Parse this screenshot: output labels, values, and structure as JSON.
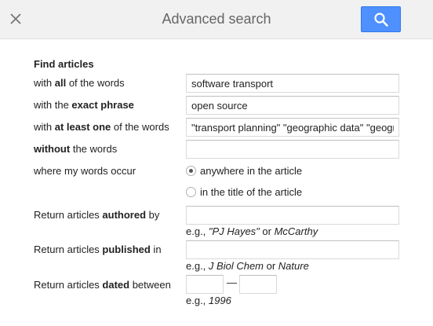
{
  "header": {
    "title": "Advanced search",
    "close_icon": "close-icon",
    "search_icon": "search-icon",
    "accent_color": "#4d90fe"
  },
  "form": {
    "section_title": "Find articles",
    "all_words": {
      "pre": "with ",
      "bold": "all",
      "post": " of the words",
      "value": "software transport"
    },
    "exact_phrase": {
      "pre": "with the ",
      "bold": "exact phrase",
      "post": "",
      "value": "open source"
    },
    "at_least_one": {
      "pre": "with ",
      "bold": "at least one",
      "post": " of the words",
      "value": "\"transport planning\" \"geographic data\" \"geographic information\""
    },
    "without": {
      "pre": "",
      "bold": "without",
      "post": " the words",
      "value": ""
    },
    "occur": {
      "label": "where my words occur",
      "options": [
        {
          "label": "anywhere in the article",
          "checked": true
        },
        {
          "label": "in the title of the article",
          "checked": false
        }
      ]
    },
    "authored": {
      "pre": "Return articles ",
      "bold": "authored",
      "post": " by",
      "value": "",
      "hint_pre": "e.g., ",
      "hint_ex1": "\"PJ Hayes\"",
      "hint_mid": " or ",
      "hint_ex2": "McCarthy"
    },
    "published": {
      "pre": "Return articles ",
      "bold": "published",
      "post": " in",
      "value": "",
      "hint_pre": "e.g., ",
      "hint_ex1": "J Biol Chem",
      "hint_mid": " or ",
      "hint_ex2": "Nature"
    },
    "dated": {
      "pre": "Return articles ",
      "bold": "dated",
      "post": " between",
      "from_value": "",
      "to_value": "",
      "dash": "—",
      "hint_pre": "e.g., ",
      "hint_ex1": "1996"
    }
  }
}
